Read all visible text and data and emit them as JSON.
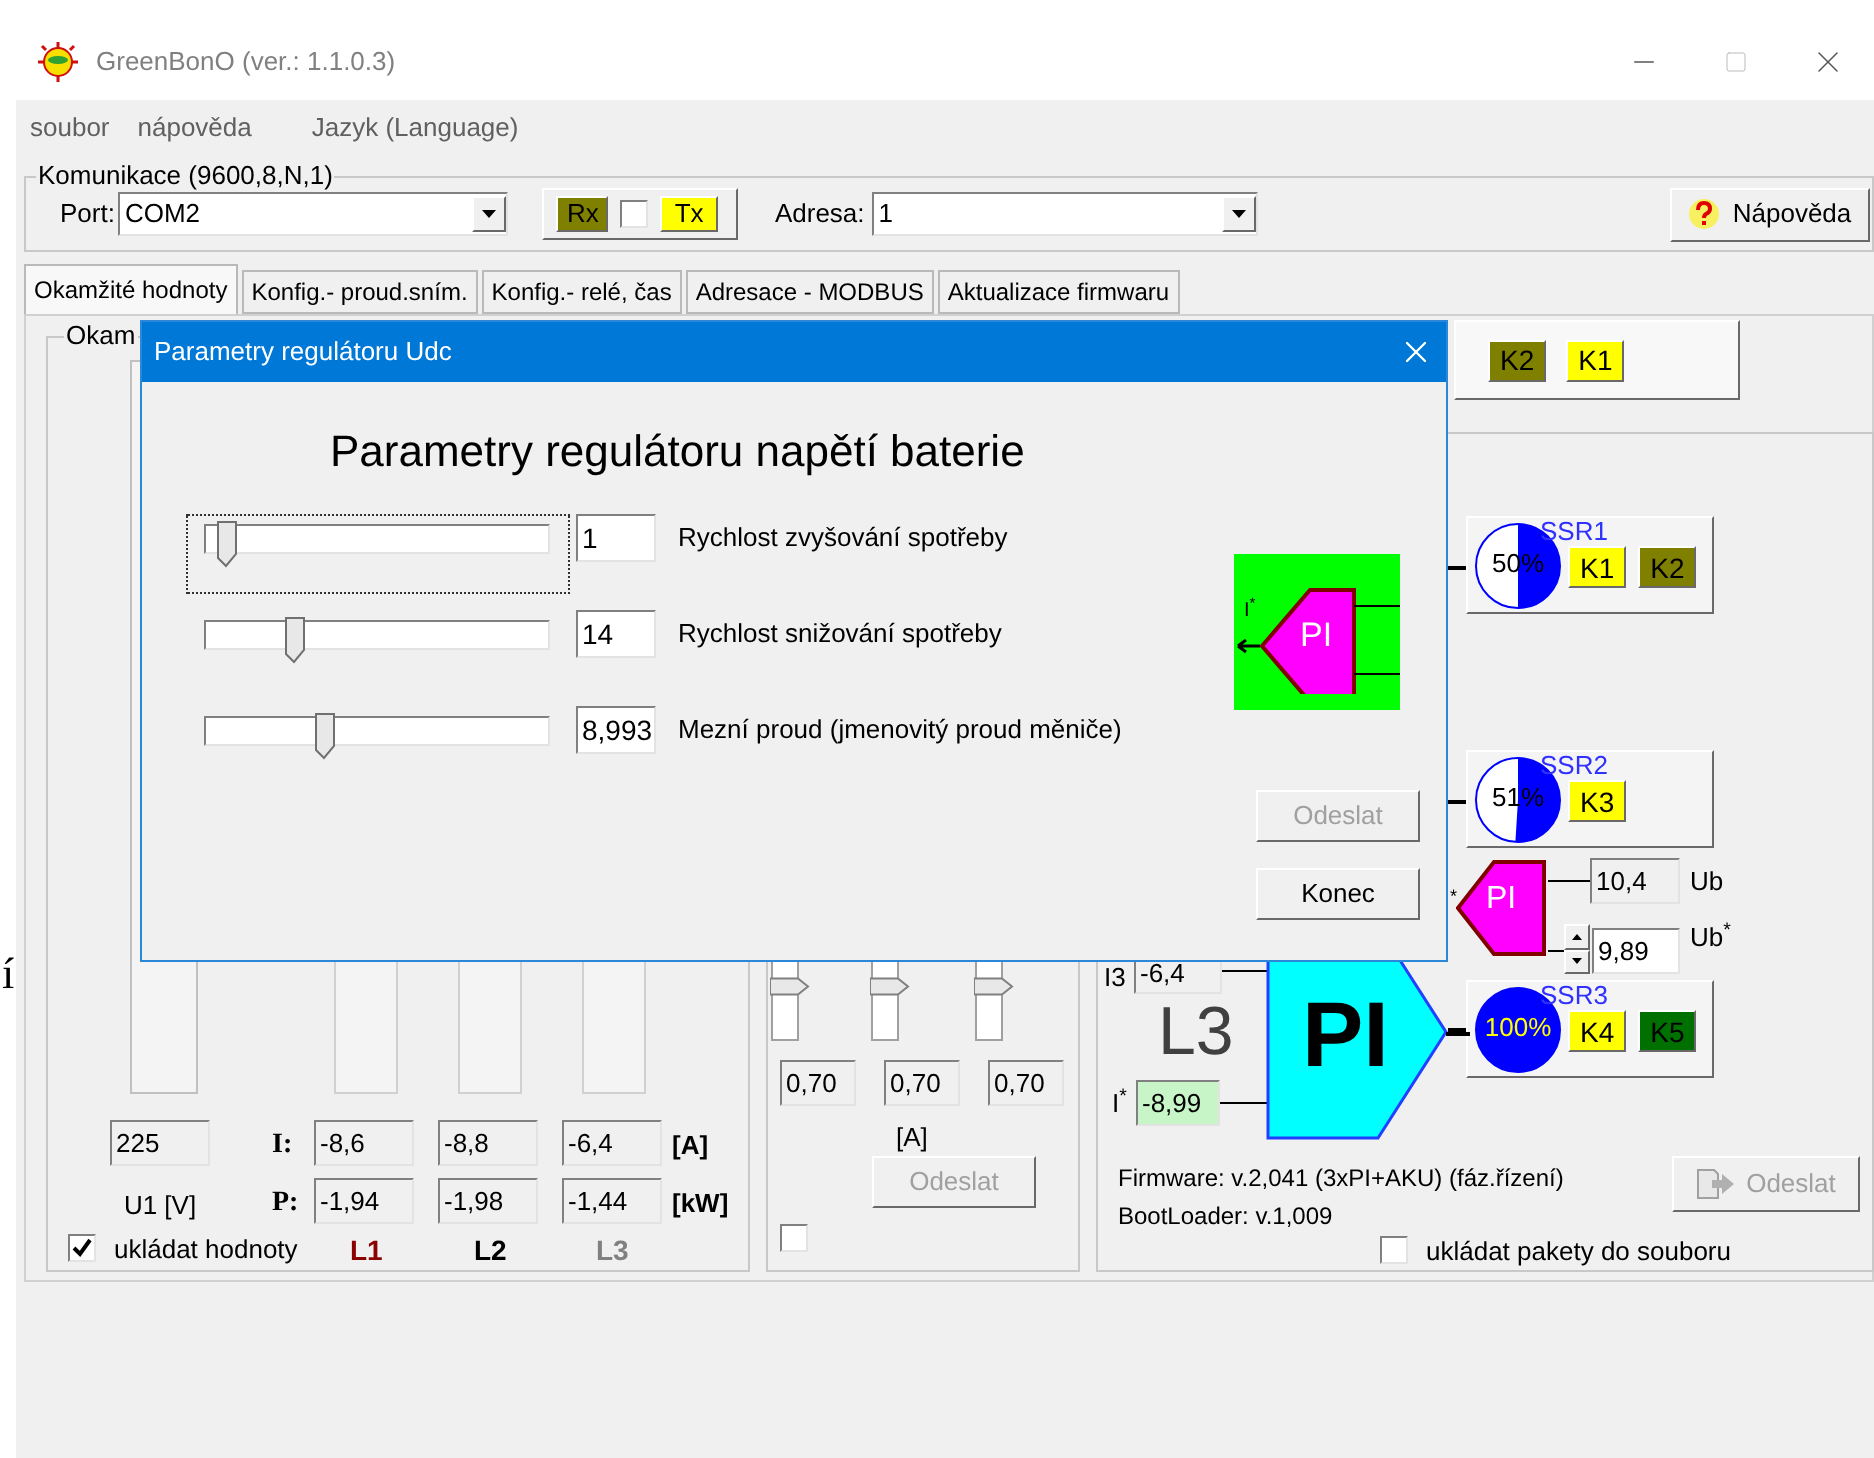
{
  "window": {
    "title": "GreenBonO (ver.: 1.1.0.3)"
  },
  "menu": [
    "soubor",
    "nápověda",
    "Jazyk (Language)"
  ],
  "communication": {
    "legend": "Komunikace (9600,8,N,1)",
    "port_label": "Port:",
    "port": "COM2",
    "rx": {
      "label": "Rx",
      "on": false
    },
    "checkbox_checked": false,
    "tx": {
      "label": "Tx",
      "on": true
    },
    "address_label": "Adresa:",
    "address": "1",
    "help_button": "Nápověda"
  },
  "tabs": [
    {
      "label": "Okamžité hodnoty",
      "selected": true
    },
    {
      "label": "Konfig.- proud.sním.",
      "selected": false
    },
    {
      "label": "Konfig.- relé, čas",
      "selected": false
    },
    {
      "label": "Adresace - MODBUS",
      "selected": false
    },
    {
      "label": "Aktualizace firmwaru",
      "selected": false
    }
  ],
  "values_panel": {
    "legend": "Okam",
    "voltage": "225",
    "voltage_label": "U1 [V]",
    "current_label": "I:",
    "currents": [
      "-8,6",
      "-8,8",
      "-6,4"
    ],
    "current_unit": "[A]",
    "power_label": "P:",
    "powers": [
      "-1,94",
      "-1,98",
      "-1,44"
    ],
    "power_unit": "[kW]",
    "save": {
      "label": "ukládat hodnoty",
      "checked": true
    },
    "phases": [
      {
        "label": "L1",
        "color": "#8b0000"
      },
      {
        "label": "L2",
        "color": "#000000"
      },
      {
        "label": "L3",
        "color": "#808080"
      }
    ]
  },
  "sensor_panel": {
    "sliders": [
      {
        "level": 0.06
      },
      {
        "level": 0.06
      },
      {
        "level": 0.06
      }
    ],
    "values": [
      "0,70",
      "0,70",
      "0,70"
    ],
    "unit": "[A]",
    "send_button": {
      "label": "Odeslat",
      "disabled": true
    },
    "checkbox_checked": false
  },
  "regulator_panel": {
    "top_relays": [
      {
        "label": "K2",
        "color": "#808000"
      },
      {
        "label": "K1",
        "color": "#ffff00"
      }
    ],
    "ssr": [
      {
        "label": "SSR1",
        "percent": "50%",
        "level": 0.5,
        "relays": [
          {
            "label": "K1",
            "color": "#ffff00"
          },
          {
            "label": "K2",
            "color": "#808000"
          }
        ]
      },
      {
        "label": "SSR2",
        "percent": "51%",
        "level": 0.51,
        "relays": [
          {
            "label": "K3",
            "color": "#ffff00"
          }
        ]
      },
      {
        "label": "SSR3",
        "percent": "100%",
        "level": 1,
        "relays": [
          {
            "label": "K4",
            "color": "#ffff00"
          },
          {
            "label": "K5",
            "color": "#007000"
          }
        ]
      }
    ],
    "small_pi": {
      "label": "PI",
      "input_label": "*"
    },
    "ub_value": "10,4",
    "ub_label": "Ub",
    "ub_target": "9,89",
    "ub_target_label": "Ub$^{*}$",
    "i3_label": "I3",
    "i3_value": "-6,4",
    "phase": "L3",
    "i_target_label": "I$^{*}$",
    "i_target": "-8,99",
    "big_pi": "PI",
    "firmware": "Firmware: v.2,041 (3xPI+AKU) (fáz.řízení)",
    "bootloader": "BootLoader: v.1,009",
    "send_button": {
      "label": "Odeslat",
      "disabled": true
    },
    "save_packets": {
      "label": "ukládat pakety do souboru",
      "checked": false
    }
  },
  "dialog": {
    "title": "Parametry regulátoru Udc",
    "heading": "Parametry regulátoru napětí baterie",
    "sliders": [
      {
        "label": "Rychlost zvyšování spotřeby",
        "value": "1",
        "level": 0.03,
        "focused": true
      },
      {
        "label": "Rychlost snižování spotřeby",
        "value": "14",
        "level": 0.24,
        "focused": false
      },
      {
        "label": "Mezní proud (jmenovitý proud měniče)",
        "value": "8,993",
        "level": 0.33,
        "focused": false
      }
    ],
    "diagram": {
      "block_label": "PI",
      "input_label": "I$^{*}$"
    },
    "buttons": [
      {
        "label": "Odeslat",
        "disabled": true
      },
      {
        "label": "Konec",
        "disabled": false
      }
    ]
  },
  "background_fragment": "í"
}
